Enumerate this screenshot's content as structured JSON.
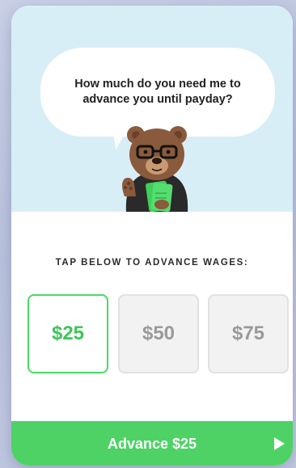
{
  "speech_bubble": {
    "line1": "How much do you need me to",
    "line2": "advance you until payday?"
  },
  "prompt": {
    "label": "TAP BELOW TO ADVANCE WAGES:"
  },
  "amount_options": [
    {
      "label": "$25",
      "selected": true
    },
    {
      "label": "$50",
      "selected": false
    },
    {
      "label": "$75",
      "selected": false
    }
  ],
  "cta": {
    "label": "Advance $25",
    "arrow_icon": "chevron-right-icon"
  },
  "colors": {
    "accent_green": "#4ed265",
    "hero_background": "#d8eef6",
    "option_inactive_text": "#9a9a9a"
  },
  "illustration": {
    "icon": "bear-mascot-icon"
  }
}
